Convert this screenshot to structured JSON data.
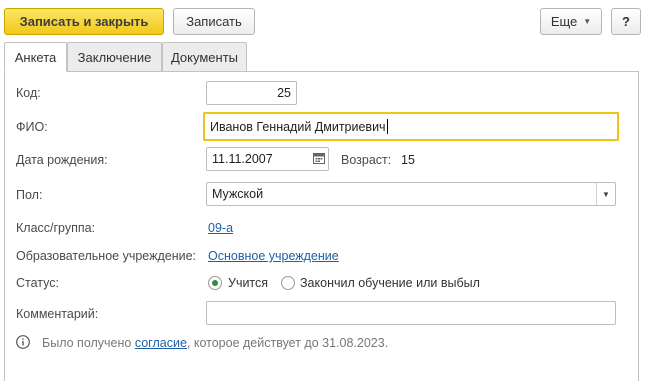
{
  "toolbar": {
    "save_close": "Записать и закрыть",
    "save": "Записать",
    "more": "Еще",
    "help": "?"
  },
  "tabs": [
    {
      "label": "Анкета",
      "active": true
    },
    {
      "label": "Заключение",
      "active": false
    },
    {
      "label": "Документы",
      "active": false
    }
  ],
  "form": {
    "code_label": "Код:",
    "code_value": "25",
    "fio_label": "ФИО:",
    "fio_value": "Иванов Геннадий Дмитриевич",
    "birth_label": "Дата рождения:",
    "birth_value": "11.11.2007",
    "age_label": "Возраст:",
    "age_value": "15",
    "gender_label": "Пол:",
    "gender_value": "Мужской",
    "class_label": "Класс/группа:",
    "class_value": "09-а",
    "school_label": "Образовательное учреждение:",
    "school_value": "Основное учреждение",
    "status_label": "Статус:",
    "status_options": [
      "Учится",
      "Закончил обучение или выбыл"
    ],
    "status_selected": 0,
    "comment_label": "Комментарий:",
    "comment_value": ""
  },
  "info": {
    "text_before": "Было получено ",
    "link": "согласие",
    "text_after": ", которое действует до 31.08.2023."
  },
  "colors": {
    "primary_button": "#f1c919",
    "focus_border": "#f0c419",
    "link": "#1e5fa8",
    "radio_checked": "#2e8b3a"
  }
}
